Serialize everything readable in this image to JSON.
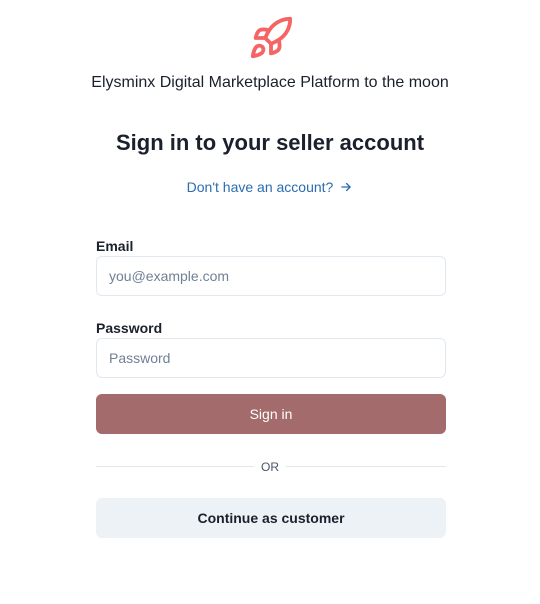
{
  "brand": {
    "logo_icon": "rocket-icon",
    "logo_color": "#f56565",
    "tagline": "Elysminx Digital Marketplace Platform to the moon"
  },
  "heading": "Sign in to your seller account",
  "signup_link": {
    "label": "Don't have an account?",
    "icon": "arrow-right-icon",
    "color": "#2b6cb0"
  },
  "form": {
    "email": {
      "label": "Email",
      "placeholder": "you@example.com",
      "value": ""
    },
    "password": {
      "label": "Password",
      "placeholder": "Password",
      "value": ""
    },
    "submit_label": "Sign in",
    "submit_color": "#a36b6b"
  },
  "divider_label": "OR",
  "customer_button_label": "Continue as customer"
}
